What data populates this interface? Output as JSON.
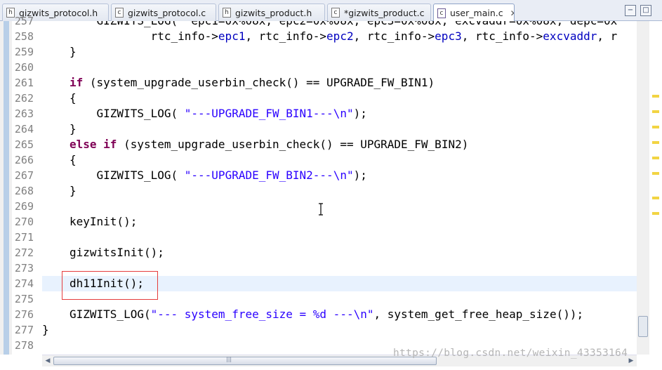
{
  "tabs": [
    {
      "label": "gizwits_protocol.h",
      "icon": "h-file-icon",
      "glyph": "h"
    },
    {
      "label": "gizwits_protocol.c",
      "icon": "c-file-icon",
      "glyph": "c"
    },
    {
      "label": "gizwits_product.h",
      "icon": "h-file-icon",
      "glyph": "h"
    },
    {
      "label": "*gizwits_product.c",
      "icon": "c-file-icon",
      "glyph": "c"
    },
    {
      "label": "user_main.c",
      "icon": "c-file-icon",
      "glyph": "c",
      "active": true,
      "close": "✕"
    }
  ],
  "window": {
    "minimize": "−",
    "maximize": "□"
  },
  "line_numbers": [
    "257",
    "258",
    "259",
    "260",
    "261",
    "262",
    "263",
    "264",
    "265",
    "266",
    "267",
    "268",
    "269",
    "270",
    "271",
    "272",
    "273",
    "274",
    "275",
    "276",
    "277",
    "278"
  ],
  "code_lines": [
    {
      "text": "    GIZWITS_LOG( \"epc1=0x%08x, epc2=0x%08x, epc3=0x%08x, excvaddr=0x%08x, depc=0x"
    },
    {
      "text": "            rtc_info->epc1, rtc_info->epc2, rtc_info->epc3, rtc_info->excvaddr, r"
    },
    {
      "text": "}"
    },
    {
      "text": ""
    },
    {
      "text": "if (system_upgrade_userbin_check() == UPGRADE_FW_BIN1)"
    },
    {
      "text": "{"
    },
    {
      "text": "    GIZWITS_LOG( \"---UPGRADE_FW_BIN1---\\n\");"
    },
    {
      "text": "}"
    },
    {
      "text": "else if (system_upgrade_userbin_check() == UPGRADE_FW_BIN2)"
    },
    {
      "text": "{"
    },
    {
      "text": "    GIZWITS_LOG( \"---UPGRADE_FW_BIN2---\\n\");"
    },
    {
      "text": "}"
    },
    {
      "text": ""
    },
    {
      "text": "keyInit();"
    },
    {
      "text": ""
    },
    {
      "text": "gizwitsInit();"
    },
    {
      "text": ""
    },
    {
      "text": "dh11Init();"
    },
    {
      "text": ""
    },
    {
      "text": "GIZWITS_LOG(\"--- system_free_size = %d ---\\n\", system_get_free_heap_size());"
    },
    {
      "text": "}"
    },
    {
      "text": ""
    }
  ],
  "current_line_number": "274",
  "watermark": "https://blog.csdn.net/weixin_43353164",
  "scroll_grip": "|||",
  "colors": {
    "keyword": "#7f0055",
    "string": "#2a00ff",
    "field": "#0000c0",
    "highlight_box": "#e53c3c",
    "current_line": "#e8f2fe"
  }
}
